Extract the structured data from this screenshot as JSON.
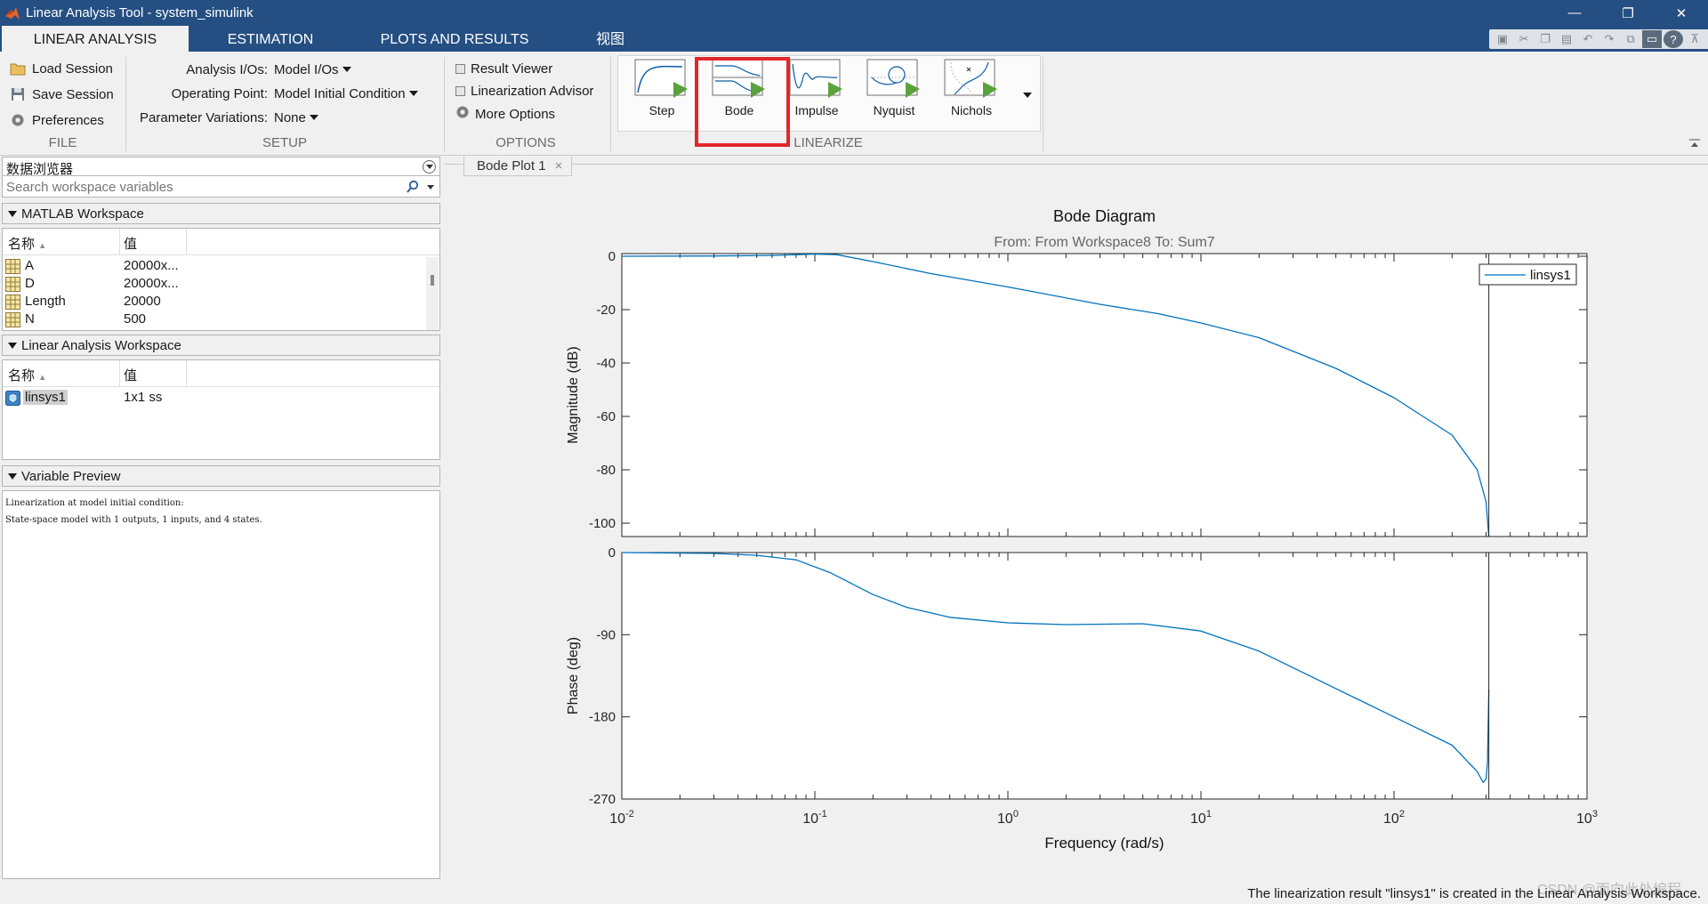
{
  "window": {
    "title": "Linear Analysis Tool - system_simulink",
    "minimize": "—",
    "restore": "❐",
    "close": "✕"
  },
  "tabs": [
    "LINEAR ANALYSIS",
    "ESTIMATION",
    "PLOTS AND RESULTS",
    "视图"
  ],
  "ribbon": {
    "file": {
      "label": "FILE",
      "load": "Load Session",
      "save": "Save Session",
      "prefs": "Preferences"
    },
    "setup": {
      "label": "SETUP",
      "io_label": "Analysis I/Os:",
      "io_value": "Model I/Os",
      "op_label": "Operating Point:",
      "op_value": "Model Initial Condition",
      "pv_label": "Parameter Variations:",
      "pv_value": "None"
    },
    "options": {
      "label": "OPTIONS",
      "result_viewer": "Result Viewer",
      "lin_advisor": "Linearization Advisor",
      "more_options": "More Options"
    },
    "linearize": {
      "label": "LINEARIZE",
      "buttons": [
        "Step",
        "Bode",
        "Impulse",
        "Nyquist",
        "Nichols"
      ]
    }
  },
  "data_browser": {
    "title": "数据浏览器",
    "search_placeholder": "Search workspace variables",
    "matlab_ws": {
      "title": "MATLAB Workspace",
      "col_name": "名称",
      "col_value": "值",
      "rows": [
        {
          "name": "A",
          "value": "20000x..."
        },
        {
          "name": "D",
          "value": "20000x..."
        },
        {
          "name": "Length",
          "value": "20000"
        },
        {
          "name": "N",
          "value": "500"
        }
      ]
    },
    "lin_ws": {
      "title": "Linear Analysis Workspace",
      "col_name": "名称",
      "col_value": "值",
      "rows": [
        {
          "name": "linsys1",
          "value": "1x1 ss"
        }
      ]
    },
    "preview": {
      "title": "Variable Preview",
      "lines": [
        "Linearization at model initial condition:",
        "State-space model with 1 outputs, 1 inputs, and 4 states."
      ]
    }
  },
  "document_tab": {
    "label": "Bode Plot 1",
    "close": "×"
  },
  "chart_data": [
    {
      "type": "line",
      "title": "Bode Diagram",
      "subtitle": "From: From Workspace8  To: Sum7",
      "xlabel": "Frequency  (rad/s)",
      "ylabel": "Magnitude (dB)",
      "xscale": "log",
      "xlim": [
        0.01,
        1000
      ],
      "ylim": [
        -105,
        1
      ],
      "yticks": [
        0,
        -20,
        -40,
        -60,
        -80,
        -100
      ],
      "series_color": "#0072bd",
      "legend_position": "top-right",
      "series": [
        {
          "name": "linsys1",
          "x": [
            0.01,
            0.03,
            0.06,
            0.1,
            0.13,
            0.2,
            0.4,
            1,
            3,
            6,
            10,
            20,
            50,
            100,
            200,
            270,
            300,
            310
          ],
          "y": [
            0,
            0.1,
            0.3,
            0.8,
            0.6,
            -2,
            -6.5,
            -11.5,
            -18,
            -21.5,
            -25,
            -30.5,
            -42,
            -53,
            -67,
            -80,
            -92,
            -105
          ]
        }
      ]
    },
    {
      "type": "line",
      "xlabel": "Frequency  (rad/s)",
      "ylabel": "Phase (deg)",
      "xscale": "log",
      "xlim": [
        0.01,
        1000
      ],
      "ylim": [
        -270,
        0
      ],
      "yticks": [
        0,
        -90,
        -180,
        -270
      ],
      "xtick_labels": [
        "10-2",
        "10-1",
        "100",
        "101",
        "102",
        "103"
      ],
      "series_color": "#0072bd",
      "series": [
        {
          "name": "linsys1",
          "x": [
            0.01,
            0.03,
            0.05,
            0.08,
            0.12,
            0.2,
            0.3,
            0.5,
            1,
            2,
            5,
            10,
            20,
            50,
            100,
            200,
            270,
            290,
            300,
            305,
            310
          ],
          "y": [
            0,
            -1,
            -3,
            -8,
            -22,
            -46,
            -60,
            -71,
            -77,
            -79,
            -78,
            -86,
            -108,
            -149,
            -180,
            -211,
            -240,
            -252,
            -248,
            -230,
            -150
          ]
        }
      ]
    }
  ],
  "status_bar": {
    "message": "The linearization result \"linsys1\" is created in the Linear Analysis Workspace."
  },
  "watermark": "CSDN @面向此处编程"
}
